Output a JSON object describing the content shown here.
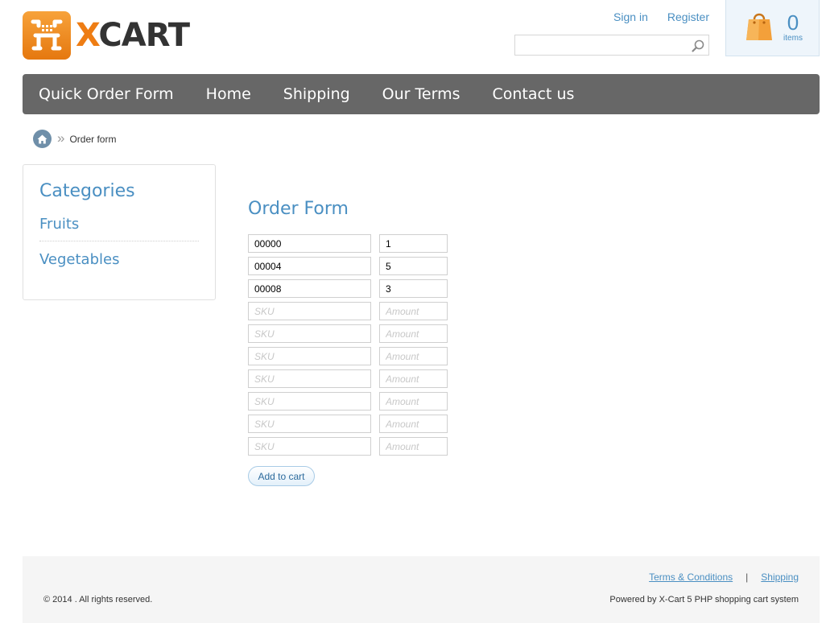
{
  "logo": {
    "brand_prefix": "X",
    "brand_suffix": "CART",
    "accent_color": "#ee7d14"
  },
  "header": {
    "sign_in": "Sign in",
    "register": "Register",
    "search_placeholder": ""
  },
  "cart": {
    "count": "0",
    "label": "items"
  },
  "nav": {
    "items": [
      {
        "label": "Quick Order Form"
      },
      {
        "label": "Home"
      },
      {
        "label": "Shipping"
      },
      {
        "label": "Our Terms"
      },
      {
        "label": "Contact us"
      }
    ]
  },
  "breadcrumb": {
    "separator": "»",
    "current": "Order form"
  },
  "sidebar": {
    "title": "Categories",
    "items": [
      {
        "label": "Fruits"
      },
      {
        "label": "Vegetables"
      }
    ]
  },
  "order_form": {
    "title": "Order Form",
    "sku_placeholder": "SKU",
    "amount_placeholder": "Amount",
    "rows": [
      {
        "sku": "00000",
        "amount": "1"
      },
      {
        "sku": "00004",
        "amount": "5"
      },
      {
        "sku": "00008",
        "amount": "3"
      },
      {
        "sku": "",
        "amount": ""
      },
      {
        "sku": "",
        "amount": ""
      },
      {
        "sku": "",
        "amount": ""
      },
      {
        "sku": "",
        "amount": ""
      },
      {
        "sku": "",
        "amount": ""
      },
      {
        "sku": "",
        "amount": ""
      },
      {
        "sku": "",
        "amount": ""
      }
    ],
    "submit_label": "Add to cart"
  },
  "footer": {
    "links": [
      {
        "label": "Terms & Conditions"
      },
      {
        "label": "Shipping"
      }
    ],
    "separator": "|",
    "copyright": "© 2014 . All rights reserved.",
    "powered_by": "Powered by X-Cart 5 PHP shopping cart system"
  },
  "colors": {
    "link": "#4a8fc2",
    "nav_bg": "#676767",
    "cart_bg": "#eef5fb",
    "footer_bg": "#f5f5f5"
  }
}
